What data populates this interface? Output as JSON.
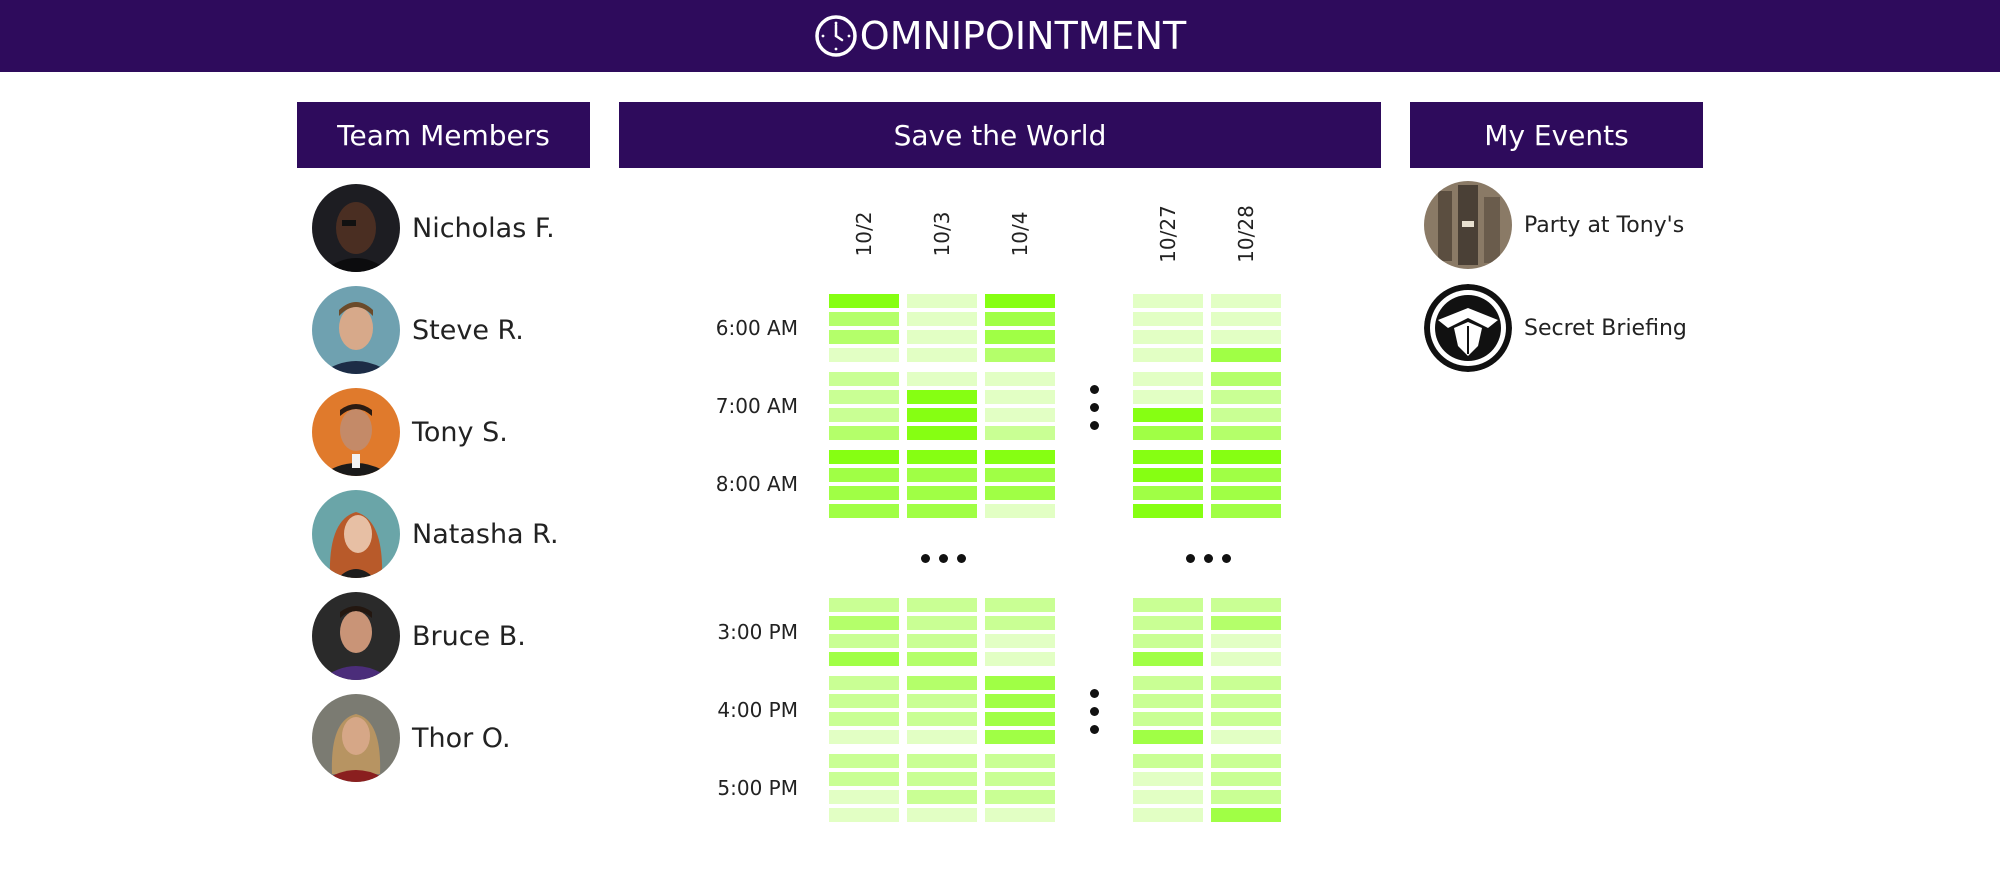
{
  "app": {
    "title": "OMNIPOINTMENT",
    "logo_icon": "clock-icon",
    "brand_color": "#2e0b5c"
  },
  "team_panel": {
    "title": "Team Members",
    "members": [
      {
        "name": "Nicholas F.",
        "avatar": "avatar-photo"
      },
      {
        "name": "Steve R.",
        "avatar": "avatar-photo"
      },
      {
        "name": "Tony S.",
        "avatar": "avatar-photo"
      },
      {
        "name": "Natasha R.",
        "avatar": "avatar-photo"
      },
      {
        "name": "Bruce B.",
        "avatar": "avatar-photo"
      },
      {
        "name": "Thor O.",
        "avatar": "avatar-photo"
      }
    ]
  },
  "schedule": {
    "title": "Save the World",
    "dates": [
      "10/2",
      "10/3",
      "10/4",
      "10/27",
      "10/28"
    ],
    "time_labels": [
      "6:00 AM",
      "7:00 AM",
      "8:00 AM",
      "3:00 PM",
      "4:00 PM",
      "5:00 PM"
    ],
    "ellipsis_icon": "ellipsis-icon",
    "availability_levels": {
      "0": "#e2ffc4",
      "1": "#c9ff94",
      "2": "#b4ff6a",
      "3": "#a0ff45",
      "4": "#86ff12"
    },
    "grid": [
      [
        4,
        0,
        4,
        0,
        0
      ],
      [
        2,
        0,
        3,
        0,
        0
      ],
      [
        2,
        0,
        3,
        0,
        0
      ],
      [
        0,
        0,
        2,
        0,
        3
      ],
      [
        1,
        0,
        0,
        0,
        2
      ],
      [
        1,
        4,
        0,
        0,
        1
      ],
      [
        1,
        4,
        0,
        4,
        1
      ],
      [
        2,
        4,
        1,
        3,
        2
      ],
      [
        4,
        4,
        4,
        4,
        4
      ],
      [
        3,
        3,
        3,
        4,
        3
      ],
      [
        3,
        3,
        3,
        3,
        3
      ],
      [
        3,
        3,
        0,
        4,
        3
      ],
      [
        1,
        1,
        1,
        1,
        1
      ],
      [
        2,
        1,
        1,
        1,
        2
      ],
      [
        1,
        1,
        0,
        1,
        0
      ],
      [
        3,
        2,
        0,
        3,
        0
      ],
      [
        1,
        2,
        3,
        1,
        1
      ],
      [
        1,
        1,
        3,
        1,
        1
      ],
      [
        1,
        1,
        3,
        1,
        1
      ],
      [
        0,
        0,
        3,
        3,
        0
      ],
      [
        1,
        1,
        1,
        1,
        1
      ],
      [
        1,
        1,
        1,
        0,
        1
      ],
      [
        0,
        1,
        1,
        0,
        1
      ],
      [
        0,
        0,
        0,
        0,
        3
      ]
    ]
  },
  "events_panel": {
    "title": "My Events",
    "events": [
      {
        "name": "Party at Tony's",
        "icon": "tower-photo-icon"
      },
      {
        "name": "Secret Briefing",
        "icon": "eagle-shield-icon"
      }
    ]
  }
}
